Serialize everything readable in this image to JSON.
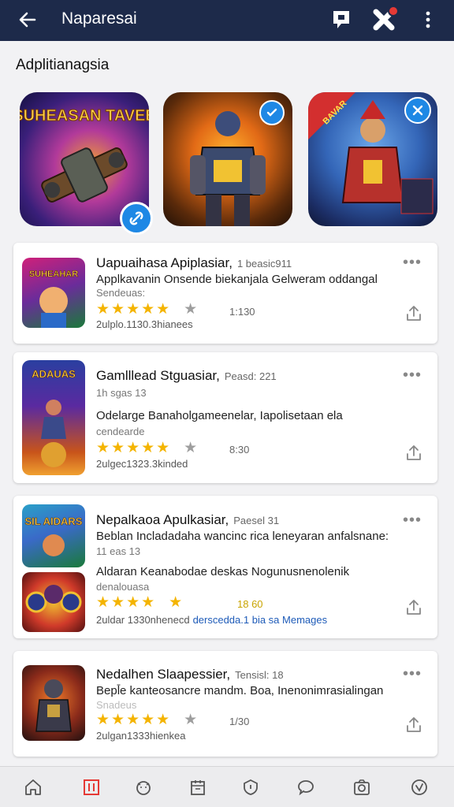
{
  "header": {
    "title": "Naparesai",
    "back_icon": "arrow-left-icon",
    "actions": [
      "chat-icon",
      "close-x-icon",
      "more-vertical-icon"
    ],
    "colors": {
      "bar": "#1d2a4a",
      "badge": "#e53935"
    }
  },
  "section": {
    "title": "Adplitianagsia"
  },
  "featured": [
    {
      "art_text": "SUHEASAN TAVEE",
      "badge_icon": "link-icon"
    },
    {
      "art_text": "",
      "badge_icon": "check-icon"
    },
    {
      "art_text": "BAVAR",
      "badge_icon": "close-icon"
    }
  ],
  "apps": [
    {
      "thumb_text": "SUHEAHAR",
      "name": "Uapuaihasa Apiplasiar,",
      "meta": "1 beasic911",
      "desc1": "Applkavanin Onsende biekanjala Gelweram oddangal",
      "desc2": "Sendeuas:",
      "desc3": "",
      "stars_full": "★★★★★",
      "stars_gray": "★",
      "rating_count": "1:130",
      "downloads": "2ulplo.1130.3hianees",
      "link_text": ""
    },
    {
      "thumb_text": "ADAUAS",
      "name": "Gamlllead Stguasiar,",
      "meta": "Peasd: 221",
      "desc1": "1h sgas 13",
      "desc2": "Odelarge Banaholgameenelar, Iapolisetaan ela",
      "desc3": "cendearde",
      "stars_full": "★★★★★",
      "stars_gray": "★",
      "rating_count": "8:30",
      "downloads": "2ulgec1323.3kinded",
      "link_text": ""
    },
    {
      "thumb_text": "SIL AIDARS",
      "name": "Nepalkaoa Apulkasiar,",
      "meta": "Paesel 31",
      "desc1": "Beblan Incladadaha wancinc rica leneyaran anfalsnane:",
      "desc2": "11 eas 13",
      "desc3": "Aldaran Keanabodae deskas Nogunusnenolenik",
      "desc4": "denalouasa",
      "stars_full": "★★★★",
      "stars_gray": "★",
      "rating_count": "18 60",
      "downloads": "2uldar 1330nhenecd",
      "link_text": "derscedda.1 bia sa Memages"
    },
    {
      "thumb_text": "",
      "name": "Nedalhen Slaapessier,",
      "meta": "Tensisl: 18",
      "desc1": "Bepl̄e kanteosancre mandm. Boa, Inenonimrasialingan",
      "desc2": "Snadeus",
      "desc3": "",
      "stars_full": "★★★★★",
      "stars_gray": "★",
      "rating_count": "1/30",
      "downloads": "2ulgan1333hienkea",
      "link_text": ""
    }
  ],
  "nav": [
    "home-icon",
    "bookmark-icon",
    "face-icon",
    "calendar-icon",
    "shield-icon",
    "chat-bubble-icon",
    "camera-icon",
    "check-circle-icon"
  ]
}
